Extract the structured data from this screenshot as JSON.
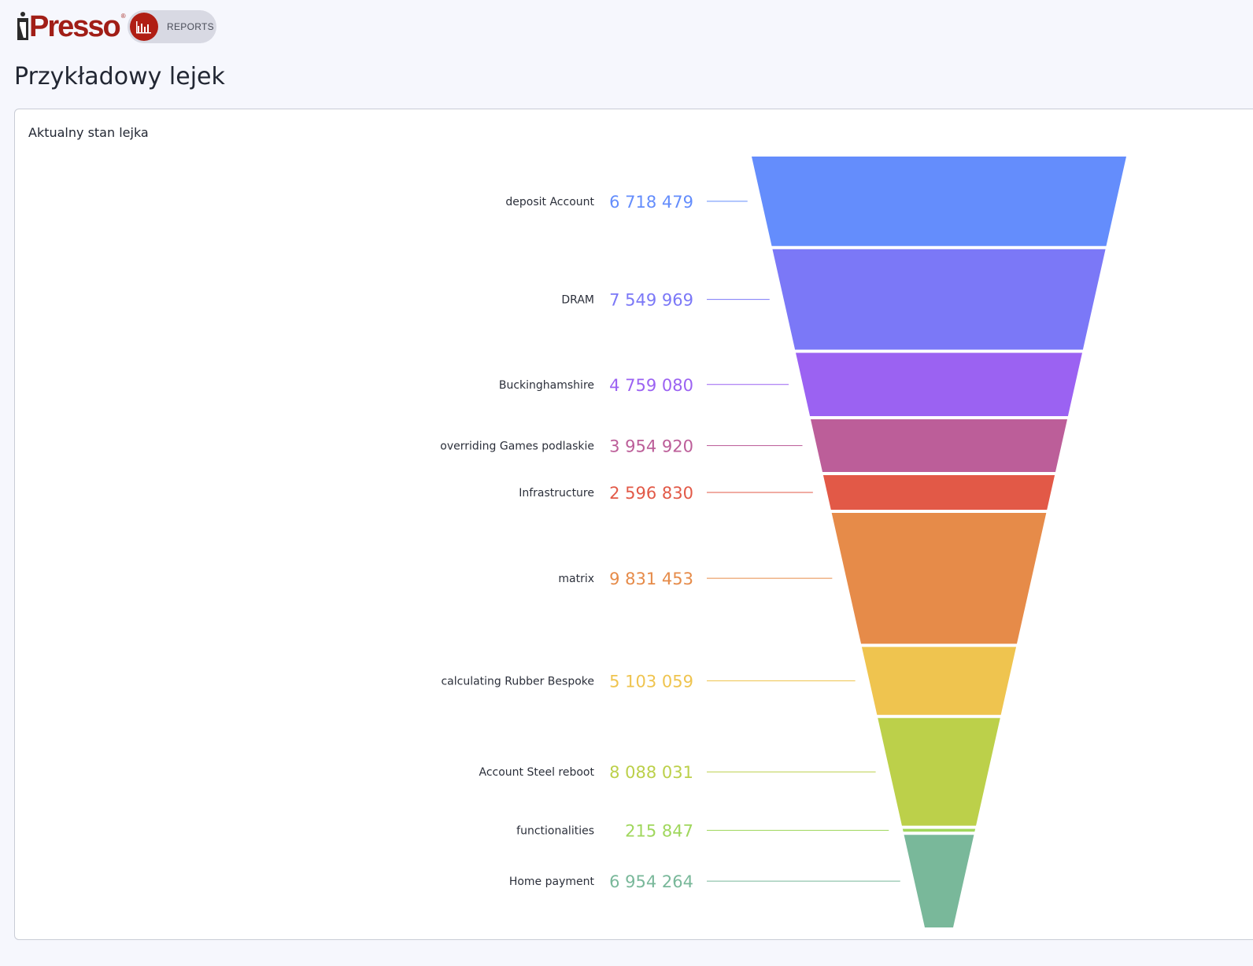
{
  "app": {
    "logo_text": "iPresso",
    "reports_label": "REPORTS"
  },
  "page": {
    "title": "Przykładowy lejek"
  },
  "card": {
    "title": "Aktualny stan lejka"
  },
  "chart_data": {
    "type": "funnel",
    "title": "Aktualny stan lejka",
    "stages": [
      {
        "name": "deposit Account",
        "value": 6718479,
        "label": "6 718 479",
        "color": "#648dfc"
      },
      {
        "name": "DRAM",
        "value": 7549969,
        "label": "7 549 969",
        "color": "#7b78f7"
      },
      {
        "name": "Buckinghamshire",
        "value": 4759080,
        "label": "4 759 080",
        "color": "#9b62f2"
      },
      {
        "name": "overriding Games podlaskie",
        "value": 3954920,
        "label": "3 954 920",
        "color": "#bc5e99"
      },
      {
        "name": "Infrastructure",
        "value": 2596830,
        "label": "2 596 830",
        "color": "#e25947"
      },
      {
        "name": "matrix",
        "value": 9831453,
        "label": "9 831 453",
        "color": "#e68b49"
      },
      {
        "name": "calculating Rubber Bespoke",
        "value": 5103059,
        "label": "5 103 059",
        "color": "#efc44f"
      },
      {
        "name": "Account Steel reboot",
        "value": 8088031,
        "label": "8 088 031",
        "color": "#bcd04a"
      },
      {
        "name": "functionalities",
        "value": 215847,
        "label": "215 847",
        "color": "#a0d75d"
      },
      {
        "name": "Home payment",
        "value": 6954264,
        "label": "6 954 264",
        "color": "#79b89a"
      }
    ]
  }
}
